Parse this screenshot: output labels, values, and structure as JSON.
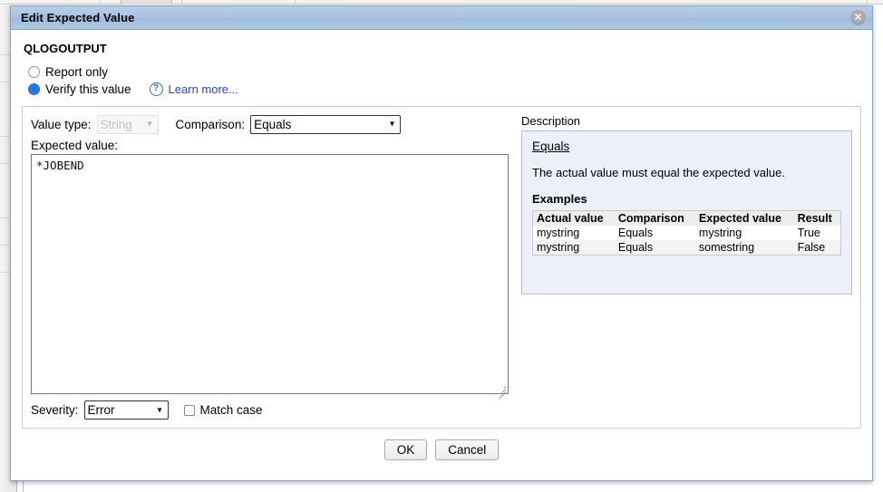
{
  "dialog": {
    "title": "Edit Expected Value",
    "close_icon": "close-icon",
    "variable_name": "QLOGOUTPUT",
    "options": {
      "report_only": "Report only",
      "verify_this_value": "Verify this value"
    },
    "help": {
      "icon": "help-circle-icon",
      "link_label": "Learn more..."
    },
    "form": {
      "value_type_label": "Value type:",
      "value_type_value": "String",
      "comparison_label": "Comparison:",
      "comparison_value": "Equals",
      "expected_value_label": "Expected value:",
      "expected_value_text": "*JOBEND",
      "severity_label": "Severity:",
      "severity_value": "Error",
      "match_case_label": "Match case"
    },
    "description": {
      "section_label": "Description",
      "heading": "Equals",
      "body": "The actual value must equal the expected value.",
      "examples_label": "Examples",
      "table": {
        "headers": [
          "Actual value",
          "Comparison",
          "Expected value",
          "Result"
        ],
        "rows": [
          [
            "mystring",
            "Equals",
            "mystring",
            "True"
          ],
          [
            "mystring",
            "Equals",
            "somestring",
            "False"
          ]
        ]
      }
    },
    "footer": {
      "ok_label": "OK",
      "cancel_label": "Cancel"
    }
  },
  "colors": {
    "titlebar_blue": "#a7c2e0",
    "dialog_border": "#8aa4c0",
    "link_blue": "#2a46c8",
    "radio_blue": "#1a73e8",
    "description_bg": "#eef0f9",
    "description_border": "#b6bed4"
  }
}
